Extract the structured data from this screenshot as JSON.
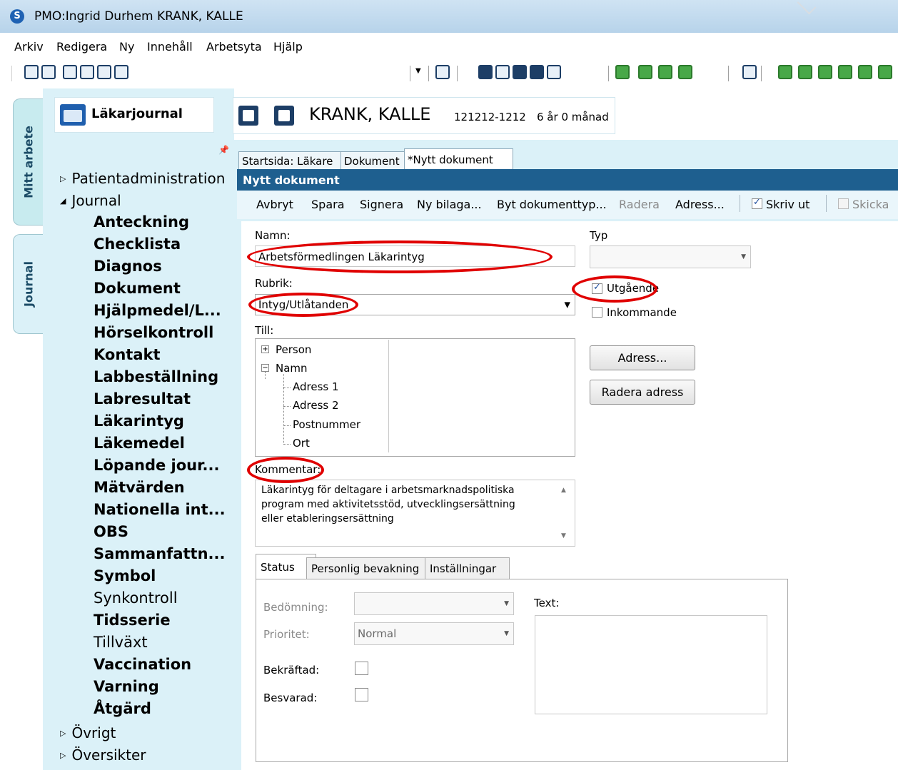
{
  "window": {
    "title": "PMO:Ingrid Durhem  KRANK, KALLE"
  },
  "menu": [
    "Arkiv",
    "Redigera",
    "Ny",
    "Innehåll",
    "Arbetsyta",
    "Hjälp"
  ],
  "side_tabs": {
    "mitt_arbete": "Mitt arbete",
    "journal": "Journal"
  },
  "nav": {
    "title": "Läkarjournal",
    "groups": {
      "patientadmin": "Patientadministration",
      "journal": "Journal",
      "ovrigt": "Övrigt",
      "oversikter": "Översikter"
    },
    "items": [
      {
        "label": "Anteckning"
      },
      {
        "label": "Checklista"
      },
      {
        "label": "Diagnos"
      },
      {
        "label": "Dokument"
      },
      {
        "label": "Hjälpmedel/L..."
      },
      {
        "label": "Hörselkontroll"
      },
      {
        "label": "Kontakt"
      },
      {
        "label": "Labbeställning"
      },
      {
        "label": "Labresultat"
      },
      {
        "label": "Läkarintyg"
      },
      {
        "label": "Läkemedel"
      },
      {
        "label": "Löpande jour..."
      },
      {
        "label": "Mätvärden"
      },
      {
        "label": "Nationella int..."
      },
      {
        "label": "OBS"
      },
      {
        "label": "Sammanfattn..."
      },
      {
        "label": "Symbol"
      },
      {
        "label": "Synkontroll"
      },
      {
        "label": "Tidsserie"
      },
      {
        "label": "Tillväxt"
      },
      {
        "label": "Vaccination"
      },
      {
        "label": "Varning"
      },
      {
        "label": "Åtgärd"
      }
    ]
  },
  "patient": {
    "name": "KRANK, KALLE",
    "id": "121212-1212",
    "age": "6 år 0 månad"
  },
  "doc_tabs": [
    "Startsida: Läkare",
    "Dokument",
    "*Nytt dokument"
  ],
  "doc_header": "Nytt dokument",
  "doc_toolbar": {
    "avbryt": "Avbryt",
    "spara": "Spara",
    "signera": "Signera",
    "ny_bilaga": "Ny bilaga...",
    "byt_typ": "Byt dokumenttyp...",
    "radera": "Radera",
    "adress": "Adress...",
    "skriv_ut": "Skriv ut",
    "skicka": "Skicka"
  },
  "form": {
    "namn_label": "Namn:",
    "namn_value": "Arbetsförmedlingen Läkarintyg",
    "typ_label": "Typ",
    "rubrik_label": "Rubrik:",
    "rubrik_value": "Intyg/Utlåtanden",
    "utgaende": "Utgående",
    "inkommande": "Inkommande",
    "till_label": "Till:",
    "tree": {
      "person": "Person",
      "namn": "Namn",
      "adress1": "Adress 1",
      "adress2": "Adress 2",
      "postnummer": "Postnummer",
      "ort": "Ort"
    },
    "adress_btn": "Adress...",
    "radera_adress_btn": "Radera adress",
    "kommentar_label": "Kommentar:",
    "kommentar_lines": [
      "Läkarintyg för deltagare i arbetsmarknadspolitiska",
      "program med aktivitetsstöd, utvecklingsersättning",
      "eller etableringsersättning"
    ]
  },
  "bottom_tabs": [
    "Status",
    "Personlig bevakning",
    "Inställningar"
  ],
  "status": {
    "bedomning_label": "Bedömning:",
    "prioritet_label": "Prioritet:",
    "prioritet_value": "Normal",
    "bekraftad_label": "Bekräftad:",
    "besvarad_label": "Besvarad:",
    "text_label": "Text:"
  },
  "accent_colors": {
    "header_blue": "#1e5f8f",
    "panel": "#dbf1f8",
    "highlight_red": "#e00000"
  }
}
